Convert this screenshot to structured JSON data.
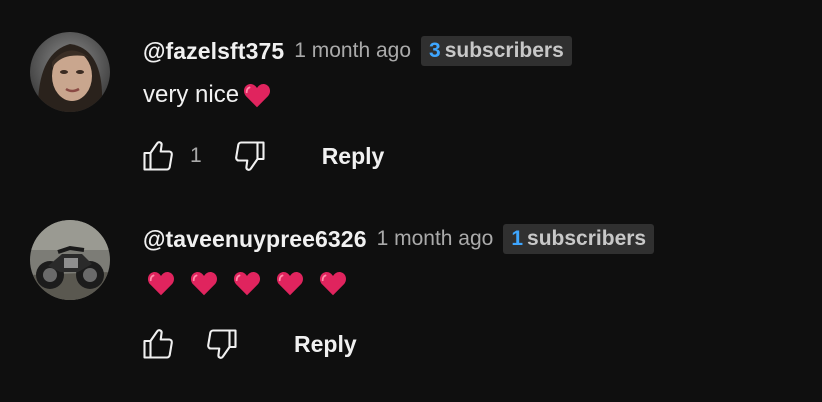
{
  "comments": [
    {
      "author": "@fazelsft375",
      "time": "1 month ago",
      "badge_count": "3",
      "badge_word": "subscribers",
      "text": "very nice",
      "like_count": "1",
      "reply_label": "Reply"
    },
    {
      "author": "@taveenuypree6326",
      "time": "1 month ago",
      "badge_count": "1",
      "badge_word": "subscribers",
      "text": "",
      "like_count": "",
      "reply_label": "Reply"
    }
  ],
  "colors": {
    "background": "#0f0f0f",
    "badge_count": "#3ea6ff",
    "heart": "#e0245e"
  }
}
